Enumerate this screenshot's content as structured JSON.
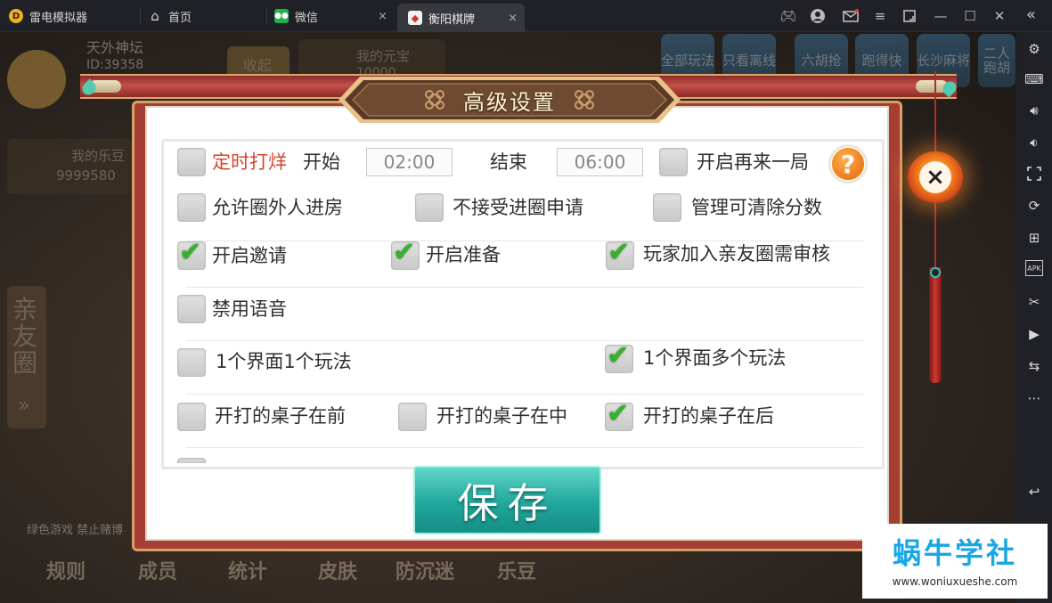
{
  "emulator": {
    "brand_label": "雷电模拟器",
    "tabs": [
      {
        "label": "首页",
        "icon": "home-icon"
      },
      {
        "label": "微信",
        "icon": "wechat-icon"
      },
      {
        "label": "衡阳棋牌",
        "icon": "app-icon",
        "active": true
      }
    ],
    "close_tab_symbol": "×",
    "window_controls": [
      "gamepad-icon",
      "user-icon",
      "mail-icon",
      "menu-icon",
      "resize-icon",
      "minimize-icon",
      "maximize-icon",
      "close-icon"
    ],
    "sidebar_icons": [
      "settings-icon",
      "keyboard-icon",
      "volume-up-icon",
      "volume-down-icon",
      "screenshot-icon",
      "rotate-icon",
      "add-app-icon",
      "apk-icon",
      "scissors-icon",
      "video-icon",
      "sync-icon",
      "more-icon",
      "back-icon"
    ],
    "sidebar_apk_text": "APK"
  },
  "background": {
    "club_name": "天外神坛",
    "club_id": "ID:39358",
    "collapse_label": "收起",
    "my_yuanbao": "我的元宝",
    "yuanbao_value": "10000",
    "my_ledou": "我的乐豆",
    "ledou_value": "9999580",
    "side_tab": "亲友圈",
    "side_tab_arrow": "»",
    "filter_tabs": [
      "全部玩法",
      "只看离线",
      "六胡抢",
      "跑得快",
      "长沙麻将",
      "二人跑胡"
    ],
    "notice": "绿色游戏 禁止赌博",
    "bottom_nav": [
      "规则",
      "成员",
      "统计",
      "皮肤",
      "防沉迷",
      "乐豆"
    ]
  },
  "dialog": {
    "title": "高级设置",
    "help_symbol": "?",
    "close_symbol": "×",
    "save_label": "保存",
    "rows": {
      "timed": {
        "label": "定时打烊",
        "start_label": "开始",
        "start_time": "02:00",
        "end_label": "结束",
        "end_time": "06:00",
        "checked": false
      },
      "replay": {
        "label": "开启再来一局",
        "checked": false
      },
      "outside_join": {
        "label": "允许圈外人进房",
        "checked": false
      },
      "no_apply": {
        "label": "不接受进圈申请",
        "checked": false
      },
      "admin_clear": {
        "label": "管理可清除分数",
        "checked": false
      },
      "invite": {
        "label": "开启邀请",
        "checked": true
      },
      "ready": {
        "label": "开启准备",
        "checked": true
      },
      "review": {
        "label": "玩家加入亲友圈需审核",
        "checked": true
      },
      "mute": {
        "label": "禁用语音",
        "checked": false
      },
      "single_mode": {
        "label": "1个界面1个玩法",
        "checked": false
      },
      "multi_mode": {
        "label": "1个界面多个玩法",
        "checked": true
      },
      "table_front": {
        "label": "开打的桌子在前",
        "checked": false
      },
      "table_middle": {
        "label": "开打的桌子在中",
        "checked": false
      },
      "table_back": {
        "label": "开打的桌子在后",
        "checked": true
      }
    },
    "tick_symbol": "✔"
  },
  "watermark": {
    "title": "蜗牛学社",
    "url": "www.woniuxueshe.com"
  },
  "colors": {
    "accent_red": "#d6442f",
    "check_green": "#35b12c",
    "save_teal": "#21a79c",
    "frame_red": "#a63e36",
    "watermark_blue": "#18a7e4"
  }
}
